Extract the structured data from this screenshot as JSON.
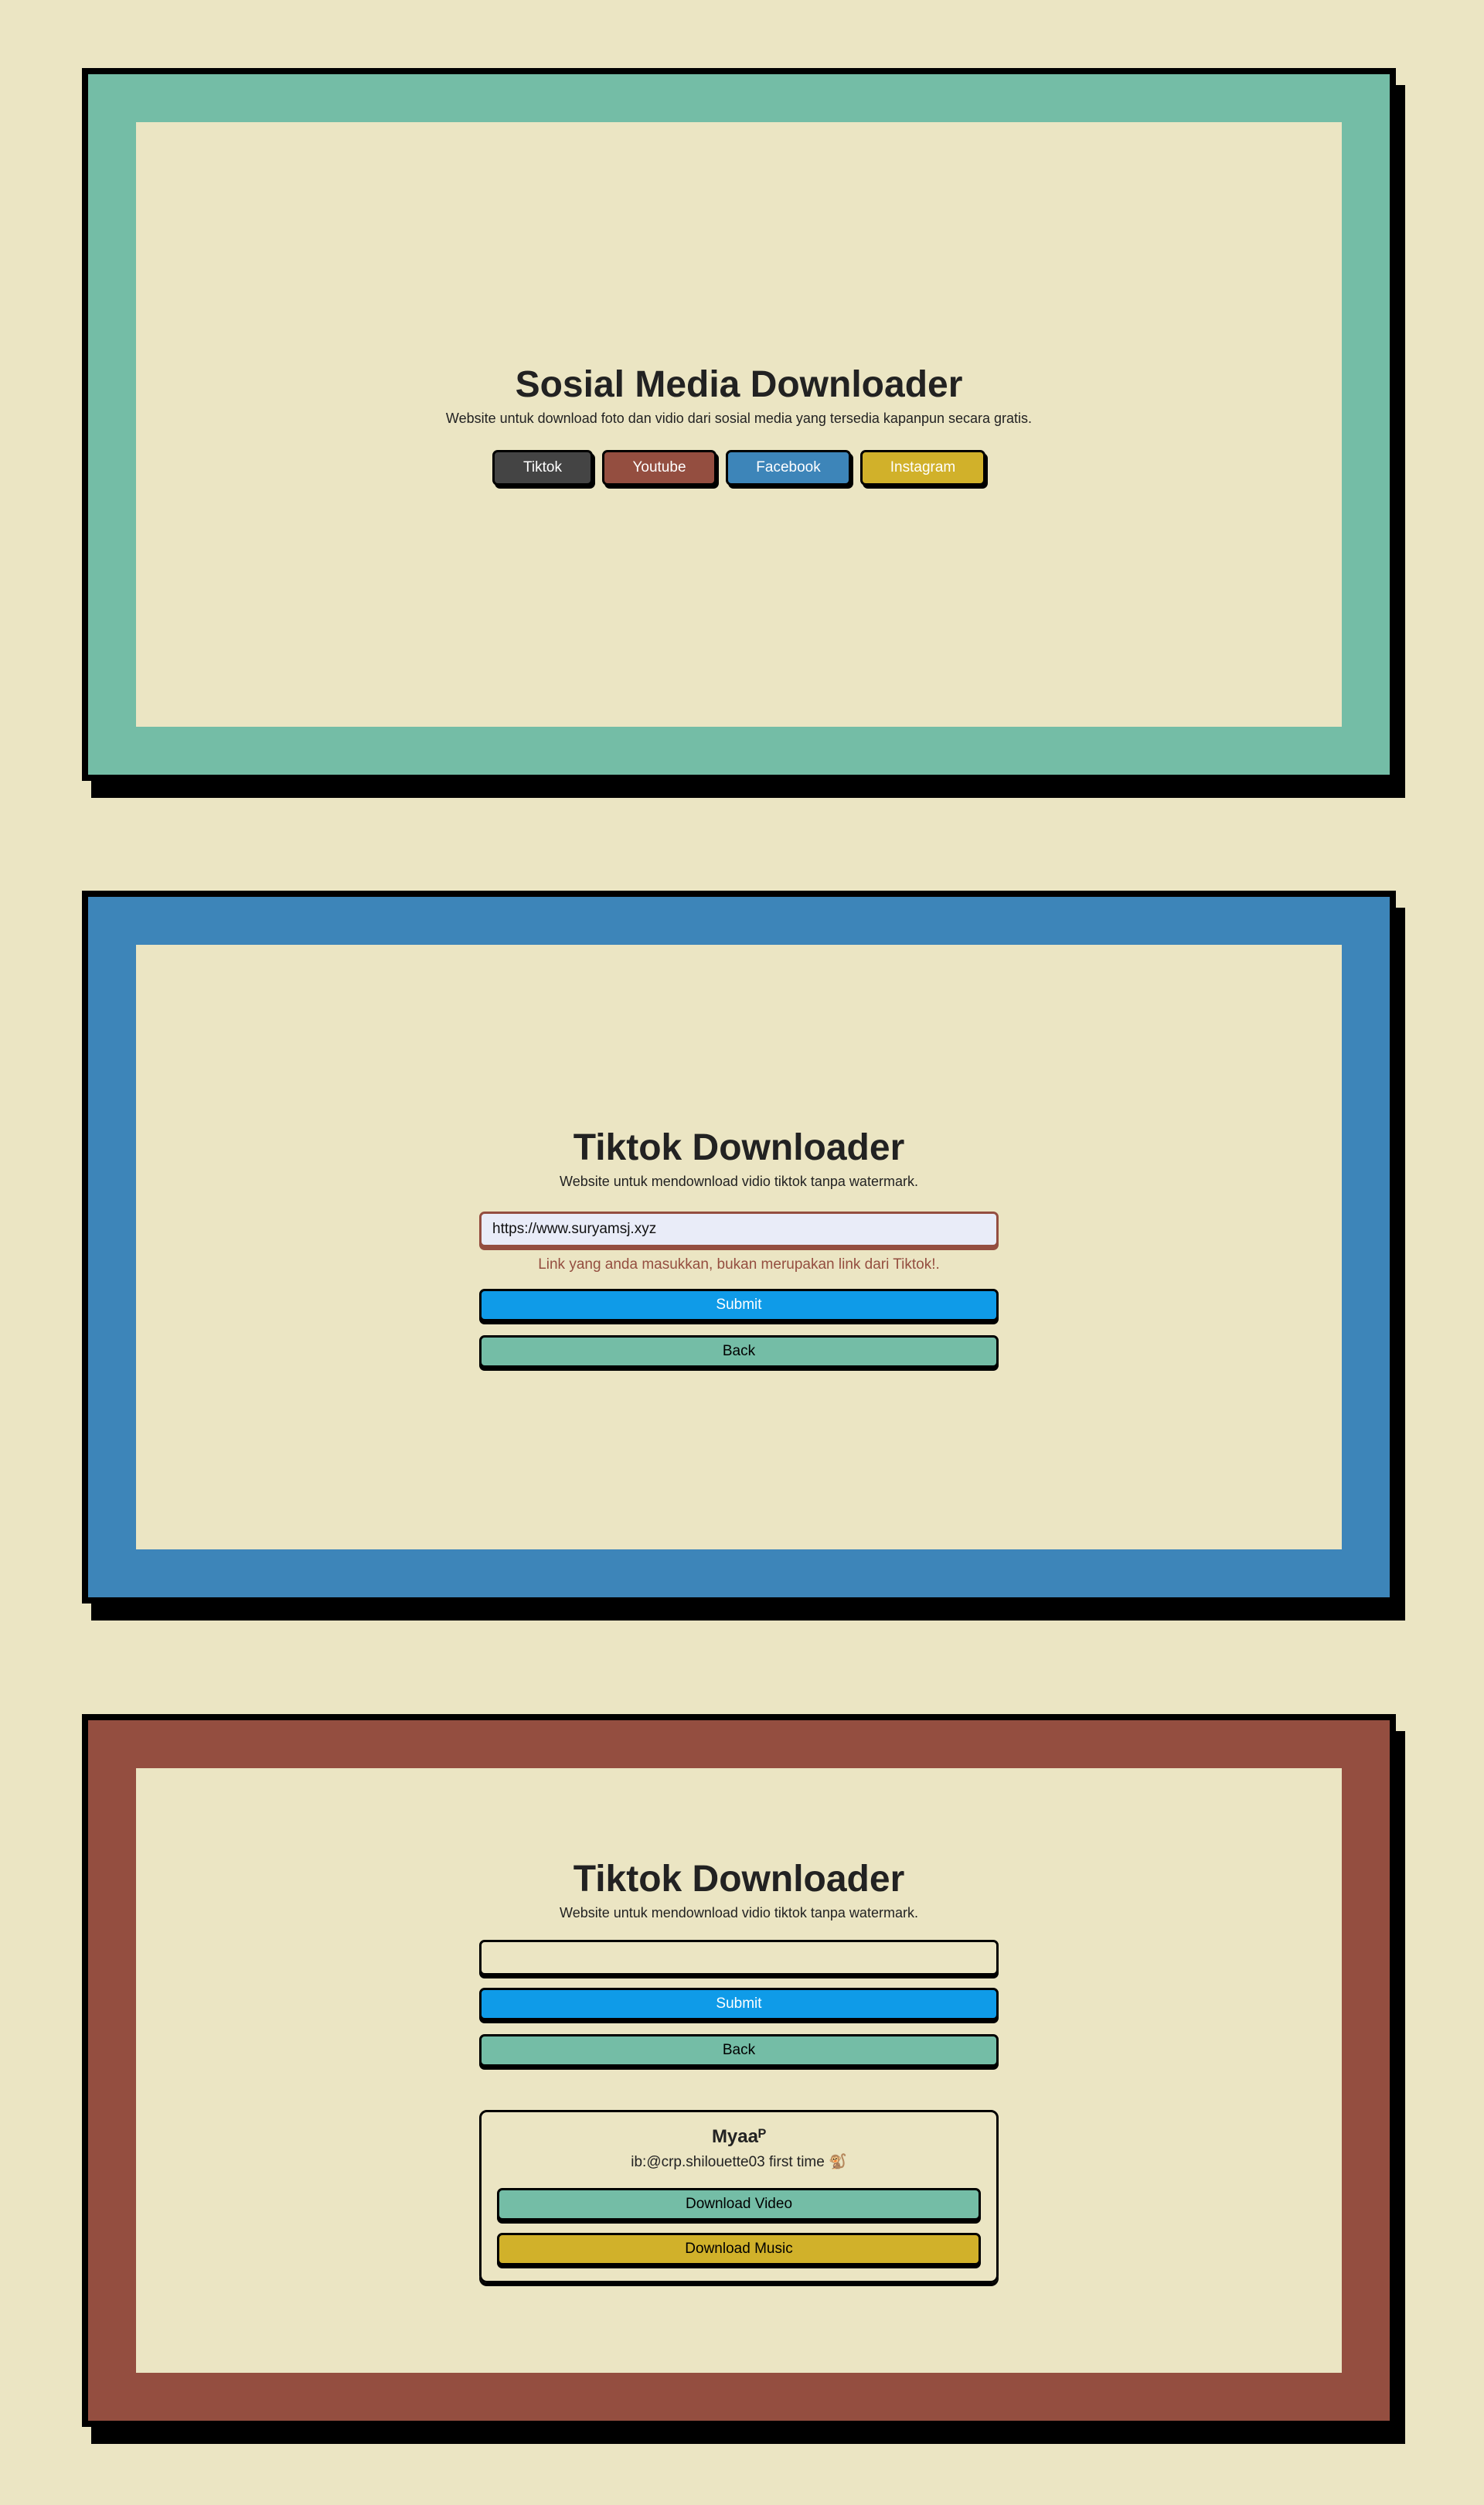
{
  "home": {
    "title": "Sosial Media Downloader",
    "subtitle": "Website untuk download foto dan vidio dari sosial media yang tersedia kapanpun secara gratis.",
    "buttons": [
      {
        "label": "Tiktok",
        "color": "#444444"
      },
      {
        "label": "Youtube",
        "color": "#944e40"
      },
      {
        "label": "Facebook",
        "color": "#3d85b9"
      },
      {
        "label": "Instagram",
        "color": "#d1b12a"
      }
    ]
  },
  "error_view": {
    "title": "Tiktok Downloader",
    "subtitle": "Website untuk mendownload vidio tiktok tanpa watermark.",
    "input_value": "https://www.suryamsj.xyz",
    "error_message": "Link yang anda masukkan, bukan merupakan link dari Tiktok!.",
    "submit_label": "Submit",
    "back_label": "Back"
  },
  "result_view": {
    "title": "Tiktok Downloader",
    "subtitle": "Website untuk mendownload vidio tiktok tanpa watermark.",
    "input_value": "",
    "submit_label": "Submit",
    "back_label": "Back",
    "result": {
      "name": "Myaaᴾ",
      "description": "ib:@crp.shilouette03 first time 🐒",
      "download_video_label": "Download Video",
      "download_music_label": "Download Music"
    }
  },
  "colors": {
    "background": "#ebe5c3",
    "frame_green": "#74bda6",
    "frame_blue": "#3d85b9",
    "frame_red": "#944e40",
    "submit_blue": "#0f9be8",
    "error_text": "#944e40"
  }
}
